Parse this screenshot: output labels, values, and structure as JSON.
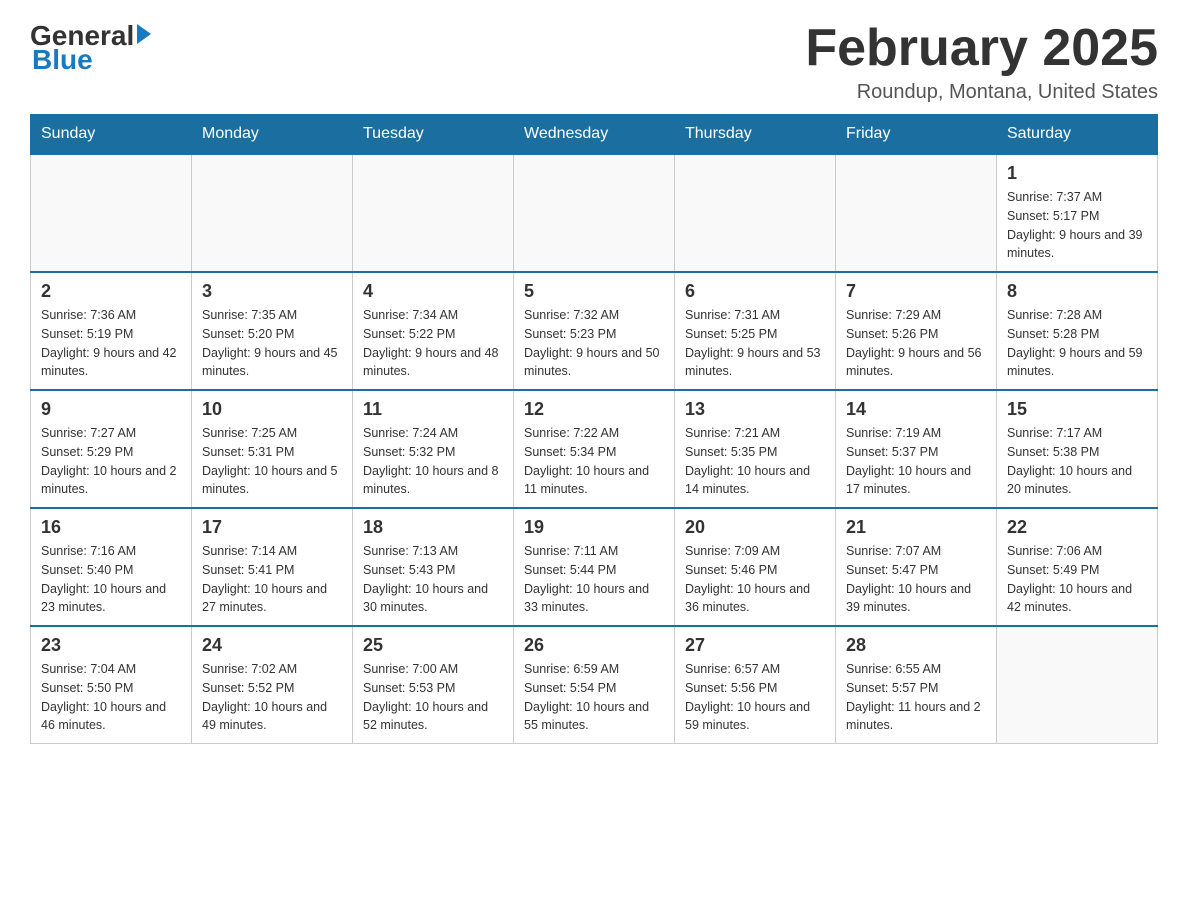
{
  "header": {
    "logo_general": "General",
    "logo_blue": "Blue",
    "month_title": "February 2025",
    "location": "Roundup, Montana, United States"
  },
  "days_of_week": [
    "Sunday",
    "Monday",
    "Tuesday",
    "Wednesday",
    "Thursday",
    "Friday",
    "Saturday"
  ],
  "weeks": [
    {
      "days": [
        {
          "num": "",
          "info": ""
        },
        {
          "num": "",
          "info": ""
        },
        {
          "num": "",
          "info": ""
        },
        {
          "num": "",
          "info": ""
        },
        {
          "num": "",
          "info": ""
        },
        {
          "num": "",
          "info": ""
        },
        {
          "num": "1",
          "info": "Sunrise: 7:37 AM\nSunset: 5:17 PM\nDaylight: 9 hours and 39 minutes."
        }
      ]
    },
    {
      "days": [
        {
          "num": "2",
          "info": "Sunrise: 7:36 AM\nSunset: 5:19 PM\nDaylight: 9 hours and 42 minutes."
        },
        {
          "num": "3",
          "info": "Sunrise: 7:35 AM\nSunset: 5:20 PM\nDaylight: 9 hours and 45 minutes."
        },
        {
          "num": "4",
          "info": "Sunrise: 7:34 AM\nSunset: 5:22 PM\nDaylight: 9 hours and 48 minutes."
        },
        {
          "num": "5",
          "info": "Sunrise: 7:32 AM\nSunset: 5:23 PM\nDaylight: 9 hours and 50 minutes."
        },
        {
          "num": "6",
          "info": "Sunrise: 7:31 AM\nSunset: 5:25 PM\nDaylight: 9 hours and 53 minutes."
        },
        {
          "num": "7",
          "info": "Sunrise: 7:29 AM\nSunset: 5:26 PM\nDaylight: 9 hours and 56 minutes."
        },
        {
          "num": "8",
          "info": "Sunrise: 7:28 AM\nSunset: 5:28 PM\nDaylight: 9 hours and 59 minutes."
        }
      ]
    },
    {
      "days": [
        {
          "num": "9",
          "info": "Sunrise: 7:27 AM\nSunset: 5:29 PM\nDaylight: 10 hours and 2 minutes."
        },
        {
          "num": "10",
          "info": "Sunrise: 7:25 AM\nSunset: 5:31 PM\nDaylight: 10 hours and 5 minutes."
        },
        {
          "num": "11",
          "info": "Sunrise: 7:24 AM\nSunset: 5:32 PM\nDaylight: 10 hours and 8 minutes."
        },
        {
          "num": "12",
          "info": "Sunrise: 7:22 AM\nSunset: 5:34 PM\nDaylight: 10 hours and 11 minutes."
        },
        {
          "num": "13",
          "info": "Sunrise: 7:21 AM\nSunset: 5:35 PM\nDaylight: 10 hours and 14 minutes."
        },
        {
          "num": "14",
          "info": "Sunrise: 7:19 AM\nSunset: 5:37 PM\nDaylight: 10 hours and 17 minutes."
        },
        {
          "num": "15",
          "info": "Sunrise: 7:17 AM\nSunset: 5:38 PM\nDaylight: 10 hours and 20 minutes."
        }
      ]
    },
    {
      "days": [
        {
          "num": "16",
          "info": "Sunrise: 7:16 AM\nSunset: 5:40 PM\nDaylight: 10 hours and 23 minutes."
        },
        {
          "num": "17",
          "info": "Sunrise: 7:14 AM\nSunset: 5:41 PM\nDaylight: 10 hours and 27 minutes."
        },
        {
          "num": "18",
          "info": "Sunrise: 7:13 AM\nSunset: 5:43 PM\nDaylight: 10 hours and 30 minutes."
        },
        {
          "num": "19",
          "info": "Sunrise: 7:11 AM\nSunset: 5:44 PM\nDaylight: 10 hours and 33 minutes."
        },
        {
          "num": "20",
          "info": "Sunrise: 7:09 AM\nSunset: 5:46 PM\nDaylight: 10 hours and 36 minutes."
        },
        {
          "num": "21",
          "info": "Sunrise: 7:07 AM\nSunset: 5:47 PM\nDaylight: 10 hours and 39 minutes."
        },
        {
          "num": "22",
          "info": "Sunrise: 7:06 AM\nSunset: 5:49 PM\nDaylight: 10 hours and 42 minutes."
        }
      ]
    },
    {
      "days": [
        {
          "num": "23",
          "info": "Sunrise: 7:04 AM\nSunset: 5:50 PM\nDaylight: 10 hours and 46 minutes."
        },
        {
          "num": "24",
          "info": "Sunrise: 7:02 AM\nSunset: 5:52 PM\nDaylight: 10 hours and 49 minutes."
        },
        {
          "num": "25",
          "info": "Sunrise: 7:00 AM\nSunset: 5:53 PM\nDaylight: 10 hours and 52 minutes."
        },
        {
          "num": "26",
          "info": "Sunrise: 6:59 AM\nSunset: 5:54 PM\nDaylight: 10 hours and 55 minutes."
        },
        {
          "num": "27",
          "info": "Sunrise: 6:57 AM\nSunset: 5:56 PM\nDaylight: 10 hours and 59 minutes."
        },
        {
          "num": "28",
          "info": "Sunrise: 6:55 AM\nSunset: 5:57 PM\nDaylight: 11 hours and 2 minutes."
        },
        {
          "num": "",
          "info": ""
        }
      ]
    }
  ]
}
